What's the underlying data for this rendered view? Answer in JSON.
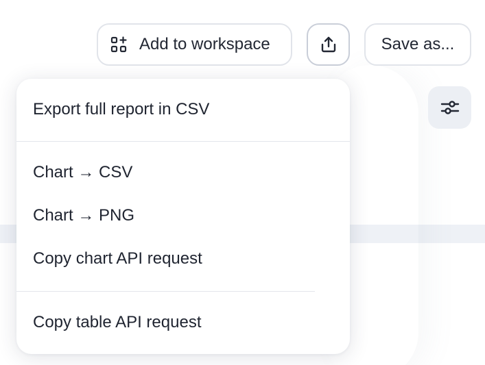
{
  "toolbar": {
    "add_to_workspace_label": "Add to workspace",
    "save_as_label": "Save as..."
  },
  "export_menu": {
    "items": [
      {
        "label": "Export full report in CSV"
      },
      {
        "label": "Chart → CSV"
      },
      {
        "label": "Chart → PNG"
      },
      {
        "label": "Copy chart API request"
      },
      {
        "label": "Copy table API request"
      }
    ]
  },
  "icons": {
    "workspace": "add-widget-icon",
    "share": "share-icon",
    "settings": "sliders-icon"
  },
  "colors": {
    "text": "#1f2430",
    "button_border": "#e1e4ea",
    "settings_bg": "#eceff4"
  }
}
